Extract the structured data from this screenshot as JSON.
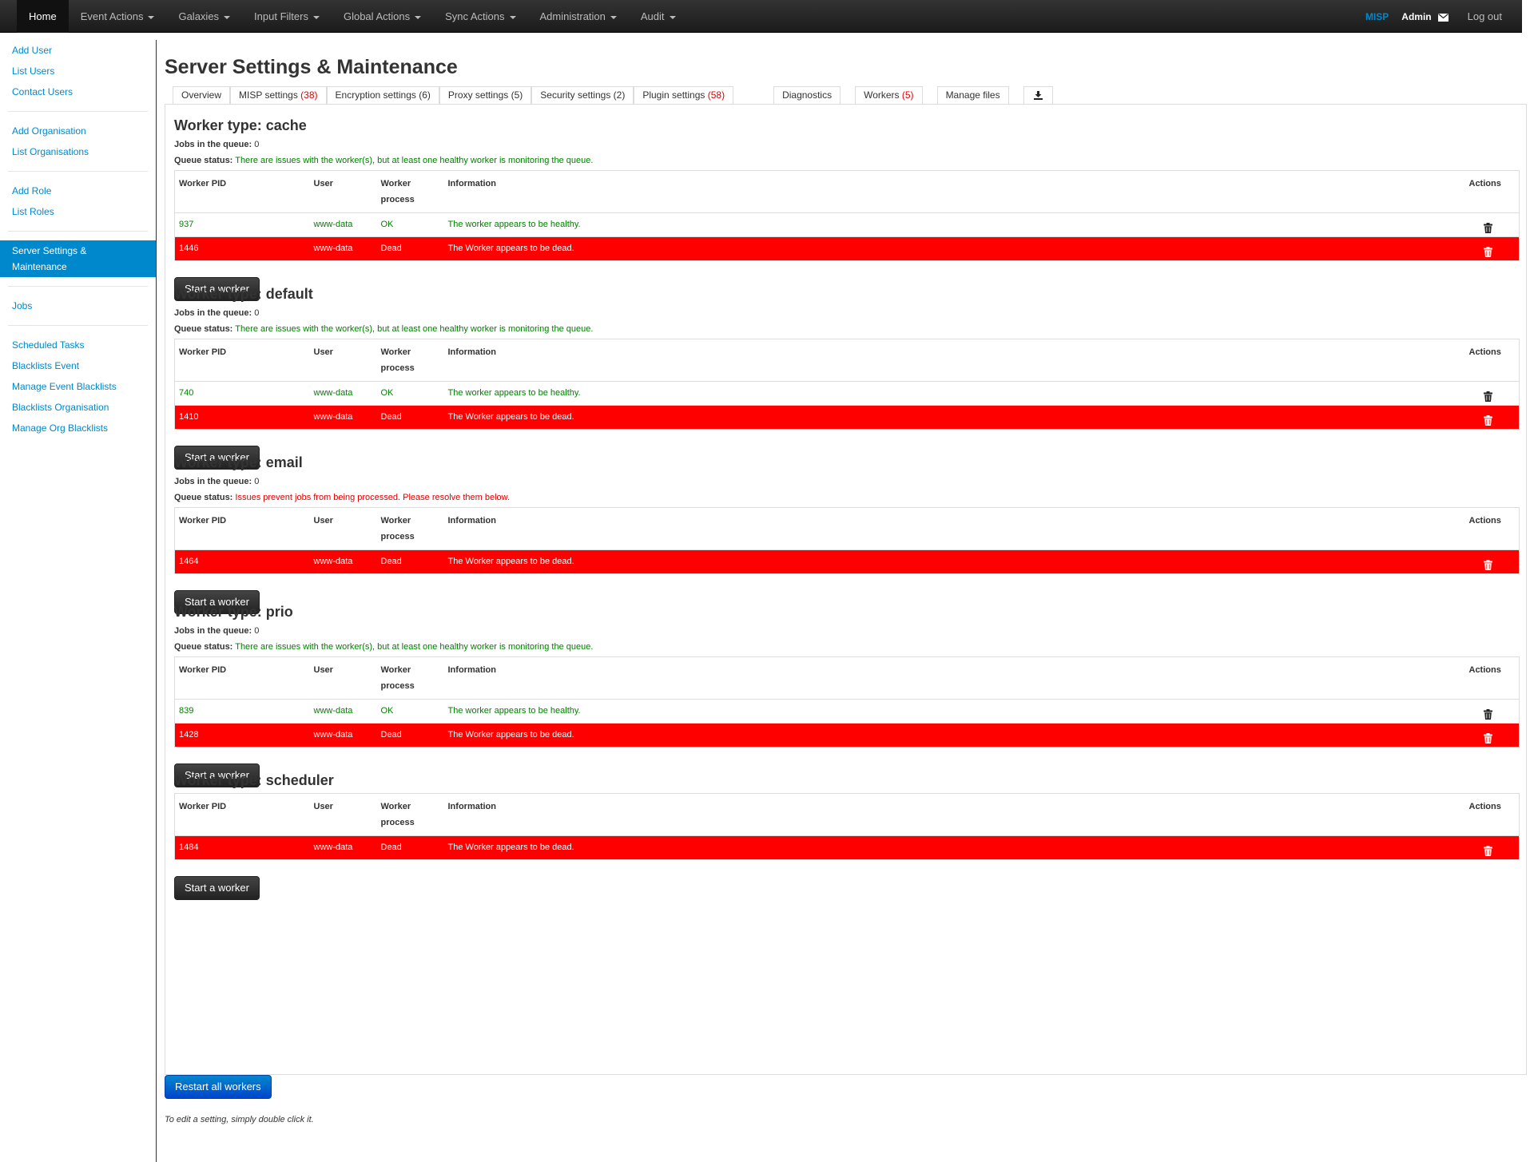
{
  "nav": {
    "items": [
      {
        "label": "Home",
        "dropdown": false,
        "active": true
      },
      {
        "label": "Event Actions",
        "dropdown": true
      },
      {
        "label": "Galaxies",
        "dropdown": true
      },
      {
        "label": "Input Filters",
        "dropdown": true
      },
      {
        "label": "Global Actions",
        "dropdown": true
      },
      {
        "label": "Sync Actions",
        "dropdown": true
      },
      {
        "label": "Administration",
        "dropdown": true
      },
      {
        "label": "Audit",
        "dropdown": true
      }
    ],
    "brand": "MISP",
    "user": "Admin",
    "logout": "Log out"
  },
  "sidebar": {
    "groups": [
      [
        "Add User",
        "List Users",
        "Contact Users"
      ],
      [
        "Add Organisation",
        "List Organisations"
      ],
      [
        "Add Role",
        "List Roles"
      ],
      [
        "Server Settings & Maintenance"
      ],
      [
        "Jobs"
      ],
      [
        "Scheduled Tasks",
        "Blacklists Event",
        "Manage Event Blacklists",
        "Blacklists Organisation",
        "Manage Org Blacklists"
      ]
    ],
    "active": "Server Settings & Maintenance"
  },
  "page": {
    "title": "Server Settings & Maintenance",
    "tabs": [
      {
        "label": "Overview",
        "count": ""
      },
      {
        "label": "MISP settings",
        "count": "(38)"
      },
      {
        "label": "Encryption settings (6)",
        "count": ""
      },
      {
        "label": "Proxy settings (5)",
        "count": ""
      },
      {
        "label": "Security settings (2)",
        "count": ""
      },
      {
        "label": "Plugin settings",
        "count": "(58)"
      },
      {
        "label": "Diagnostics",
        "count": ""
      },
      {
        "label": "Workers",
        "count": "(5)"
      },
      {
        "label": "Manage files",
        "count": ""
      }
    ],
    "download_icon": "download-icon",
    "columns": {
      "pid": "Worker PID",
      "user": "User",
      "process": "Worker process",
      "info": "Information",
      "actions": "Actions"
    },
    "jobs_label": "Jobs in the queue:",
    "status_label": "Queue status:",
    "start_label": "Start a worker",
    "restart_label": "Restart all workers",
    "note": "To edit a setting, simply double click it."
  },
  "workers": [
    {
      "title": "Worker type: cache",
      "jobs": "0",
      "status": "There are issues with the worker(s), but at least one healthy worker is monitoring the queue.",
      "status_ok": true,
      "rows": [
        {
          "pid": "937",
          "user": "www-data",
          "process": "OK",
          "info": "The worker appears to be healthy.",
          "ok": true
        },
        {
          "pid": "1446",
          "user": "www-data",
          "process": "Dead",
          "info": "The Worker appears to be dead.",
          "ok": false
        }
      ]
    },
    {
      "title": "Worker type: default",
      "jobs": "0",
      "status": "There are issues with the worker(s), but at least one healthy worker is monitoring the queue.",
      "status_ok": true,
      "rows": [
        {
          "pid": "740",
          "user": "www-data",
          "process": "OK",
          "info": "The worker appears to be healthy.",
          "ok": true
        },
        {
          "pid": "1410",
          "user": "www-data",
          "process": "Dead",
          "info": "The Worker appears to be dead.",
          "ok": false
        }
      ]
    },
    {
      "title": "Worker type: email",
      "jobs": "0",
      "status": "Issues prevent jobs from being processed. Please resolve them below.",
      "status_ok": false,
      "rows": [
        {
          "pid": "1464",
          "user": "www-data",
          "process": "Dead",
          "info": "The Worker appears to be dead.",
          "ok": false
        }
      ]
    },
    {
      "title": "Worker type: prio",
      "jobs": "0",
      "status": "There are issues with the worker(s), but at least one healthy worker is monitoring the queue.",
      "status_ok": true,
      "rows": [
        {
          "pid": "839",
          "user": "www-data",
          "process": "OK",
          "info": "The worker appears to be healthy.",
          "ok": true
        },
        {
          "pid": "1428",
          "user": "www-data",
          "process": "Dead",
          "info": "The Worker appears to be dead.",
          "ok": false
        }
      ]
    },
    {
      "title": "Worker type: scheduler",
      "rows": [
        {
          "pid": "1484",
          "user": "www-data",
          "process": "Dead",
          "info": "The Worker appears to be dead.",
          "ok": false
        }
      ]
    }
  ],
  "colors": {
    "link": "#0088cc",
    "ok": "#008000",
    "dead_row": "#ff0000",
    "bad_text": "#e00000"
  }
}
